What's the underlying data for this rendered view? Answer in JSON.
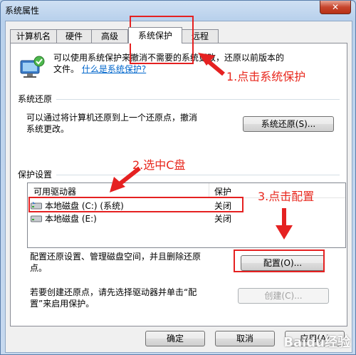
{
  "window": {
    "title": "系统属性",
    "close_label": "✕"
  },
  "tabs": [
    {
      "label": "计算机名"
    },
    {
      "label": "硬件"
    },
    {
      "label": "高级"
    },
    {
      "label": "系统保护",
      "active": true
    },
    {
      "label": "远程"
    }
  ],
  "intro": {
    "text": "可以使用系统保护来撤消不需要的系统更改，还原以前版本的文件。",
    "line1": "可以使用系统保护来撤消不需要的系统更改，还原以前版本的",
    "line2": "文件。",
    "link": "什么是系统保护?"
  },
  "restore": {
    "group_title": "系统还原",
    "line1": "可以通过将计算机还原到上一个还原点，撤消",
    "line2": "系统更改。",
    "button": "系统还原(S)..."
  },
  "protection": {
    "group_title": "保护设置",
    "columns": [
      "可用驱动器",
      "保护"
    ],
    "rows": [
      {
        "drive": "本地磁盘 (C:) (系统)",
        "protection": "关闭"
      },
      {
        "drive": "本地磁盘 (E:)",
        "protection": "关闭"
      }
    ],
    "config_line1": "配置还原设置、管理磁盘空间，并且删除还原",
    "config_line2": "点。",
    "config_button": "配置(O)...",
    "create_line1": "若要创建还原点，请先选择驱动器并单击“配",
    "create_line2": "置”来启用保护。",
    "create_button": "创建(C)..."
  },
  "footer": {
    "ok": "确定",
    "cancel": "取消",
    "apply": "应用(A)"
  },
  "annotations": {
    "step1": "1.点击系统保护",
    "step2": "2.选中C盘",
    "step3": "3.点击配置",
    "color": "#e8281e"
  },
  "watermark": "Baidu经验"
}
